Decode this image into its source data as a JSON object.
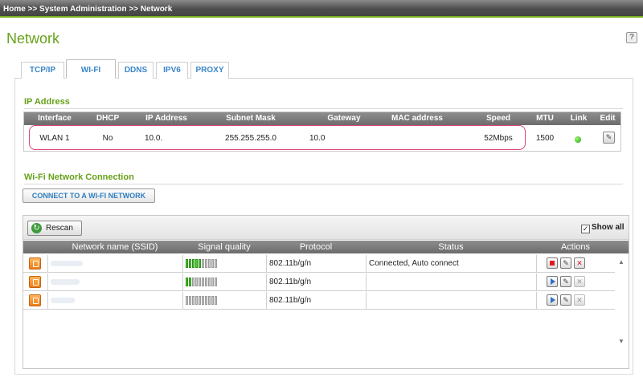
{
  "breadcrumb": "Home >> System Administration >> Network",
  "page_title": "Network",
  "help_icon_glyph": "?",
  "tabs": [
    {
      "label": "TCP/IP",
      "active": false
    },
    {
      "label": "WI-FI",
      "active": true
    },
    {
      "label": "DDNS",
      "active": false
    },
    {
      "label": "IPV6",
      "active": false
    },
    {
      "label": "PROXY",
      "active": false
    }
  ],
  "ip_section": {
    "title": "IP Address",
    "columns": [
      "Interface",
      "DHCP",
      "IP Address",
      "Subnet Mask",
      "Gateway",
      "MAC address",
      "Speed",
      "MTU",
      "Link",
      "Edit"
    ],
    "row": {
      "interface": "WLAN 1",
      "dhcp": "No",
      "ip": "10.0.",
      "subnet": "255.255.255.0",
      "gateway": "10.0",
      "mac": "",
      "speed": "52Mbps",
      "mtu": "1500",
      "link_status_color": "#2ab52a"
    }
  },
  "wifi_section": {
    "title": "Wi-Fi Network Connection",
    "connect_button": "CONNECT TO A WI-FI NETWORK",
    "rescan_button": "Rescan",
    "show_all_label": "Show all",
    "show_all_checked": true,
    "columns": [
      "Network name (SSID)",
      "Signal quality",
      "Protocol",
      "Status",
      "Actions"
    ],
    "rows": [
      {
        "ssid": "",
        "signal_bars": 5,
        "protocol": "802.11b/g/n",
        "status": "Connected, Auto connect",
        "connected": true
      },
      {
        "ssid": "",
        "signal_bars": 2,
        "protocol": "802.11b/g/n",
        "status": "",
        "connected": false
      },
      {
        "ssid": "",
        "signal_bars": 0,
        "protocol": "802.11b/g/n",
        "status": "",
        "connected": false
      }
    ]
  },
  "colors": {
    "accent_green": "#67a11a",
    "link_blue": "#3a86c8",
    "highlight_pink": "#e0437d"
  }
}
